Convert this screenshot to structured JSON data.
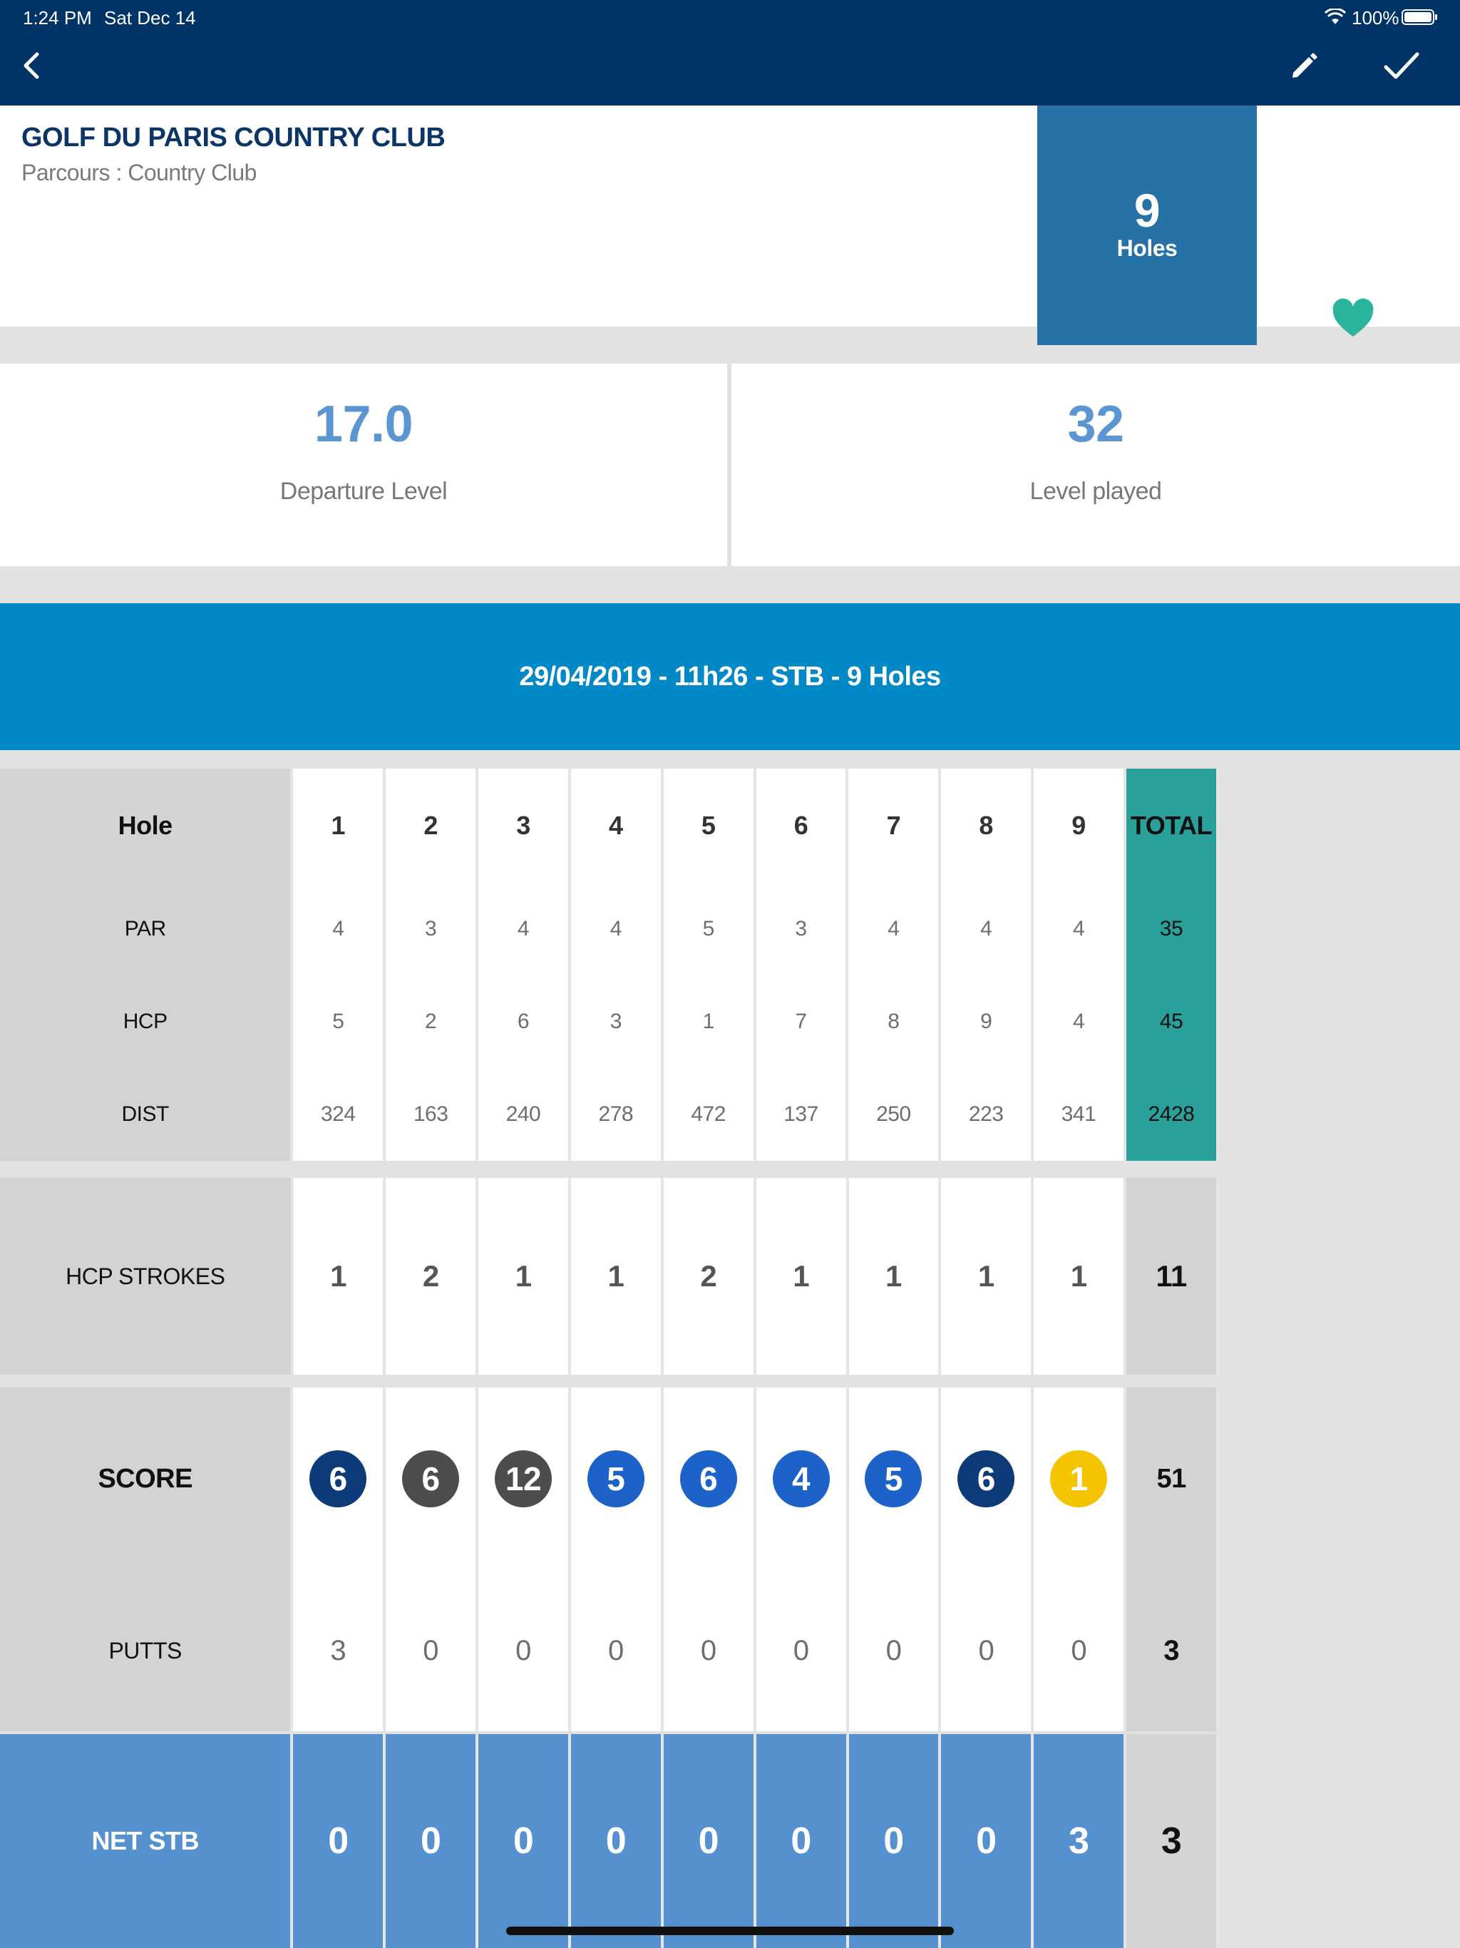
{
  "status_bar": {
    "time": "1:24 PM",
    "date": "Sat Dec 14",
    "battery": "100%"
  },
  "icons": {
    "back": "chevron-left-icon",
    "edit": "pencil-icon",
    "confirm": "checkmark-icon",
    "favorite": "heart-icon",
    "wifi": "wifi-icon",
    "battery": "battery-icon"
  },
  "colors": {
    "navbar": "#003366",
    "accent_blue": "#0089c6",
    "holes_box": "#2672a6",
    "favorite": "#2ab49c",
    "total_green": "#2aa09a",
    "net_row": "#5590cf"
  },
  "club": {
    "name": "GOLF DU PARIS COUNTRY CLUB",
    "course": "Parcours : Country Club",
    "holes_count": "9",
    "holes_label": "Holes"
  },
  "levels": {
    "departure": {
      "value": "17.0",
      "label": "Departure Level"
    },
    "played": {
      "value": "32",
      "label": "Level played"
    }
  },
  "round": {
    "title": "29/04/2019 - 11h26 - STB - 9 Holes"
  },
  "scorecard": {
    "hole_label": "Hole",
    "holes": [
      "1",
      "2",
      "3",
      "4",
      "5",
      "6",
      "7",
      "8",
      "9"
    ],
    "total_label": "TOTAL",
    "par": {
      "label": "PAR",
      "values": [
        "4",
        "3",
        "4",
        "4",
        "5",
        "3",
        "4",
        "4",
        "4"
      ],
      "total": "35"
    },
    "hcp": {
      "label": "HCP",
      "values": [
        "5",
        "2",
        "6",
        "3",
        "1",
        "7",
        "8",
        "9",
        "4"
      ],
      "total": "45"
    },
    "dist": {
      "label": "DIST",
      "values": [
        "324",
        "163",
        "240",
        "278",
        "472",
        "137",
        "250",
        "223",
        "341"
      ],
      "total": "2428"
    },
    "hcp_strokes": {
      "label": "HCP STROKES",
      "values": [
        "1",
        "2",
        "1",
        "1",
        "2",
        "1",
        "1",
        "1",
        "1"
      ],
      "total": "11"
    },
    "score": {
      "label": "SCORE",
      "values": [
        "6",
        "6",
        "12",
        "5",
        "6",
        "4",
        "5",
        "6",
        "1"
      ],
      "colors": [
        "#0d3a78",
        "#4d4d4d",
        "#4d4d4d",
        "#1d62c9",
        "#1d62c9",
        "#1d62c9",
        "#1d62c9",
        "#0d3a78",
        "#f5c400"
      ],
      "total": "51"
    },
    "putts": {
      "label": "PUTTS",
      "values": [
        "3",
        "0",
        "0",
        "0",
        "0",
        "0",
        "0",
        "0",
        "0"
      ],
      "total": "3"
    },
    "net_stb": {
      "label": "NET STB",
      "values": [
        "0",
        "0",
        "0",
        "0",
        "0",
        "0",
        "0",
        "0",
        "3"
      ],
      "total": "3"
    }
  }
}
